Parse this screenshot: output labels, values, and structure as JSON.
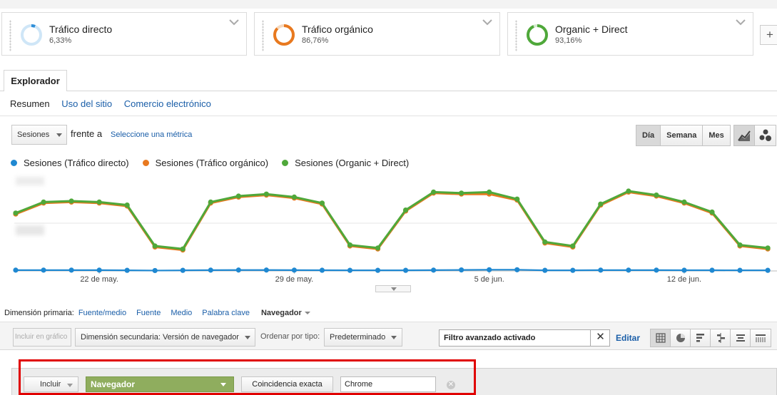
{
  "segments": [
    {
      "name": "Tráfico directo",
      "pct": "6,33%",
      "color": "#2f8fd8",
      "share": 0.0633
    },
    {
      "name": "Tráfico orgánico",
      "pct": "86,76%",
      "color": "#e8791f",
      "share": 0.8676
    },
    {
      "name": "Organic + Direct",
      "pct": "93,16%",
      "color": "#4fa83a",
      "share": 0.9316
    }
  ],
  "add_segment_label": "+",
  "tab": {
    "label": "Explorador"
  },
  "subtabs": [
    "Resumen",
    "Uso del sitio",
    "Comercio electrónico"
  ],
  "metric": {
    "selected": "Sesiones",
    "vs_label": "frente a",
    "pick_label": "Seleccione una métrica"
  },
  "period": {
    "options": [
      "Día",
      "Semana",
      "Mes"
    ],
    "active": "Día"
  },
  "legend": [
    {
      "label": "Sesiones (Tráfico directo)",
      "color": "#1f88d1"
    },
    {
      "label": "Sesiones (Tráfico orgánico)",
      "color": "#e8791f"
    },
    {
      "label": "Sesiones (Organic + Direct)",
      "color": "#4fa83a"
    }
  ],
  "chart_data": {
    "type": "line",
    "x_tick_labels": [
      {
        "label": "22 de may.",
        "index": 3
      },
      {
        "label": "29 de may.",
        "index": 10
      },
      {
        "label": "5 de jun.",
        "index": 17
      },
      {
        "label": "12 de jun.",
        "index": 24
      }
    ],
    "x_count": 28,
    "ylim": [
      0,
      100
    ],
    "series": [
      {
        "name": "Sesiones (Tráfico directo)",
        "color": "#1f88d1",
        "values": [
          0.8,
          0.8,
          0.8,
          0.8,
          0.6,
          0.4,
          0.6,
          0.8,
          0.9,
          0.9,
          0.8,
          0.7,
          0.6,
          0.6,
          0.6,
          0.8,
          1.0,
          1.2,
          1.2,
          0.6,
          0.6,
          0.8,
          0.8,
          0.8,
          0.7,
          0.7,
          0.6,
          0.6
        ]
      },
      {
        "name": "Sesiones (Tráfico orgánico)",
        "color": "#e8791f",
        "values": [
          57,
          68,
          69,
          68,
          65,
          24,
          21,
          68,
          74,
          76,
          73,
          67,
          25,
          22,
          60,
          78,
          77,
          77,
          71,
          28,
          24,
          66,
          79,
          75,
          68,
          58,
          25,
          22
        ]
      },
      {
        "name": "Sesiones (Organic + Direct)",
        "color": "#4fa83a",
        "values": [
          58,
          69,
          70,
          69,
          66,
          25,
          22,
          69,
          75,
          77,
          74,
          68,
          26,
          23,
          61,
          79,
          78,
          79,
          72,
          29,
          25,
          67,
          80,
          76,
          69,
          59,
          26,
          23
        ]
      }
    ]
  },
  "primary_dimension": {
    "label": "Dimensión primaria:",
    "options": [
      "Fuente/medio",
      "Fuente",
      "Medio",
      "Palabra clave"
    ],
    "selected": "Navegador"
  },
  "toolbar": {
    "plot_rows": "Incluir en gráfico",
    "secondary_dim": "Dimensión secundaria: Versión de navegador",
    "order_label": "Ordenar por tipo:",
    "order_value": "Predeterminado",
    "filter_status": "Filtro avanzado activado",
    "filter_clear": "✕",
    "edit": "Editar"
  },
  "filter_editor": {
    "include": "Incluir",
    "dimension": "Navegador",
    "match": "Coincidencia exacta",
    "value": "Chrome",
    "remove": "✕"
  }
}
